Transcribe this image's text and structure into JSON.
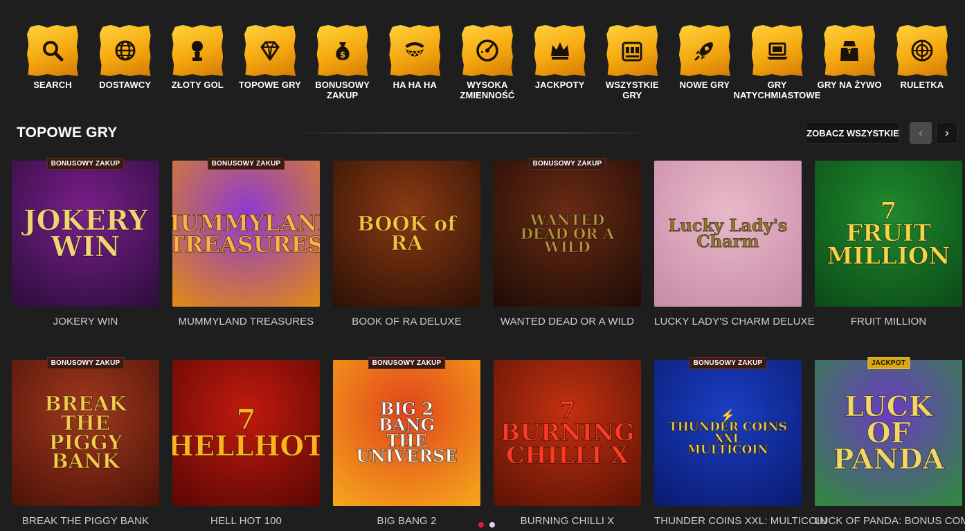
{
  "categories": [
    {
      "label": "SEARCH",
      "icon": "search-icon"
    },
    {
      "label": "DOSTAWCY",
      "icon": "globe-icon"
    },
    {
      "label": "ZŁOTY GOL",
      "icon": "trophy-icon"
    },
    {
      "label": "TOPOWE GRY",
      "icon": "diamond-icon"
    },
    {
      "label": "BONUSOWY\nZAKUP",
      "icon": "money-bag-icon"
    },
    {
      "label": "HA HA HA",
      "icon": "joker-grin-icon"
    },
    {
      "label": "WYSOKA\nZMIENNOŚĆ",
      "icon": "gauge-icon"
    },
    {
      "label": "JACKPOTY",
      "icon": "crown-icon"
    },
    {
      "label": "WSZYSTKIE\nGRY",
      "icon": "slot-machine-icon"
    },
    {
      "label": "NOWE GRY",
      "icon": "rocket-icon"
    },
    {
      "label": "GRY\nNATYCHMIASTOWE",
      "icon": "laptop-icon"
    },
    {
      "label": "GRY NA ŻYWO",
      "icon": "dealer-icon"
    },
    {
      "label": "RULETKA",
      "icon": "roulette-icon"
    }
  ],
  "section": {
    "title": "TOPOWE GRY",
    "see_all": "ZOBACZ WSZYSTKIE",
    "prev_icon": "‹",
    "next_icon": "›"
  },
  "games": [
    {
      "name": "JOKERY WIN",
      "badge": "BONUSOWY ZAKUP",
      "badge_type": "bonus",
      "logo": "JOKERY\nWIN",
      "bg": [
        "#7a1f8a",
        "#2b0d3c"
      ],
      "logo_color": "#f2d27a"
    },
    {
      "name": "MUMMYLAND TREASURES",
      "badge": "BONUSOWY ZAKUP",
      "badge_type": "bonus",
      "logo": "MUMMYLAND\nTREASURES",
      "bg": [
        "#8e3ad0",
        "#e28a12"
      ],
      "logo_color": "#ffb347"
    },
    {
      "name": "BOOK OF RA DELUXE",
      "badge": "",
      "badge_type": "",
      "logo": "BOOK of RA",
      "bg": [
        "#8a3a12",
        "#2c1006"
      ],
      "logo_color": "#f3c340"
    },
    {
      "name": "WANTED DEAD OR A WILD",
      "badge": "BONUSOWY ZAKUP",
      "badge_type": "bonus",
      "logo": "WANTED\nDEAD OR A WILD",
      "bg": [
        "#6a2a14",
        "#1e0c06"
      ],
      "logo_color": "#b7913c"
    },
    {
      "name": "LUCKY LADY'S CHARM DELUXE",
      "badge": "",
      "badge_type": "",
      "logo": "Lucky Lady's\nCharm",
      "bg": [
        "#e8b9c9",
        "#c88ba6"
      ],
      "logo_color": "#9a7a2a"
    },
    {
      "name": "FRUIT MILLION",
      "badge": "",
      "badge_type": "",
      "logo": "7\nFRUIT\nMILLION",
      "bg": [
        "#1f8a2e",
        "#0b4a17"
      ],
      "logo_color": "#f3d64a"
    },
    {
      "name": "BREAK THE PIGGY BANK",
      "badge": "BONUSOWY ZAKUP",
      "badge_type": "bonus",
      "logo": "BREAK THE\nPIGGY BANK",
      "bg": [
        "#a2381e",
        "#4b1208"
      ],
      "logo_color": "#f7c84a"
    },
    {
      "name": "HELL HOT 100",
      "badge": "",
      "badge_type": "",
      "logo": "7\nHELLHOT",
      "bg": [
        "#c11a0e",
        "#5a0704"
      ],
      "logo_color": "#ffb21c"
    },
    {
      "name": "BIG BANG 2",
      "badge": "BONUSOWY ZAKUP",
      "badge_type": "bonus",
      "logo": "BIG 2\nBANG\nTHE UNIVERSE",
      "bg": [
        "#e0441a",
        "#f7a81c"
      ],
      "logo_color": "#ffffff"
    },
    {
      "name": "BURNING CHILLI X",
      "badge": "",
      "badge_type": "",
      "logo": "7\nBURNING\nCHILLI X",
      "bg": [
        "#c2310f",
        "#5a1205"
      ],
      "logo_color": "#ff3a24"
    },
    {
      "name": "THUNDER COINS XXL: MULTICOIN",
      "badge": "BONUSOWY ZAKUP",
      "badge_type": "bonus",
      "logo": "⚡\nTHUNDER COINS XXL\nMULTICOIN",
      "bg": [
        "#1a3ec4",
        "#0a1a6e"
      ],
      "logo_color": "#ffd23a"
    },
    {
      "name": "LUCK OF PANDA: BONUS COMBO",
      "badge": "JACKPOT",
      "badge_type": "jackpot",
      "logo": "LUCK OF\nPANDA",
      "bg": [
        "#6b3cc4",
        "#2f8a3a"
      ],
      "logo_color": "#f2d66a"
    }
  ],
  "pagination": {
    "active": 0,
    "count": 2
  },
  "colors": {
    "page_bg": "#1e1e1e",
    "tile_gold": "#f5a80f",
    "badge_bonus": "#3a1a12",
    "badge_jackpot": "#d8a70f",
    "dot_active": "#e3183a"
  }
}
